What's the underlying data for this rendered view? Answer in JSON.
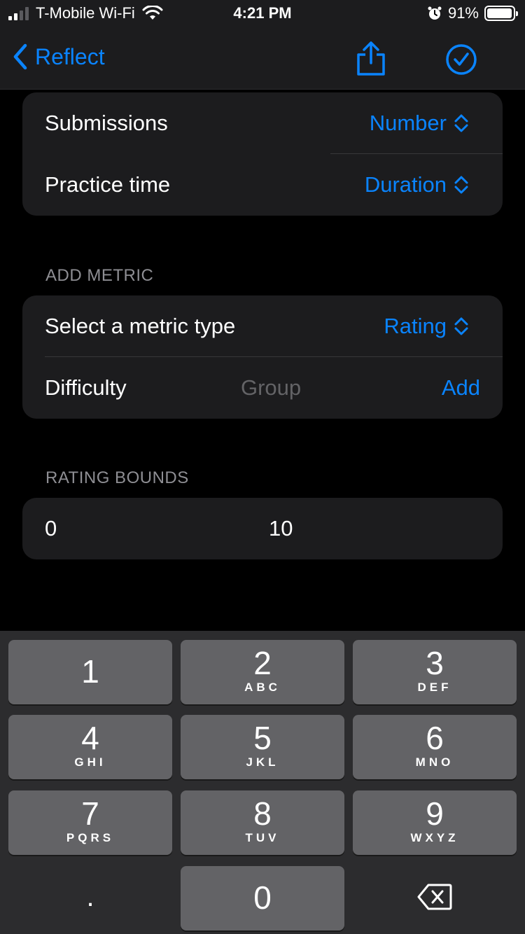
{
  "status": {
    "carrier": "T-Mobile Wi-Fi",
    "time": "4:21 PM",
    "battery": "91%"
  },
  "nav": {
    "back_label": "Reflect"
  },
  "metrics": [
    {
      "label": "Submissions",
      "value": "Number"
    },
    {
      "label": "Practice time",
      "value": "Duration"
    }
  ],
  "add_metric": {
    "header": "ADD METRIC",
    "type_label": "Select a metric type",
    "type_value": "Rating",
    "name_value": "Difficulty",
    "group_placeholder": "Group",
    "add_label": "Add"
  },
  "rating_bounds": {
    "header": "RATING BOUNDS",
    "min": "0",
    "max": "10"
  },
  "keypad": {
    "keys": [
      {
        "digit": "1",
        "letters": ""
      },
      {
        "digit": "2",
        "letters": "ABC"
      },
      {
        "digit": "3",
        "letters": "DEF"
      },
      {
        "digit": "4",
        "letters": "GHI"
      },
      {
        "digit": "5",
        "letters": "JKL"
      },
      {
        "digit": "6",
        "letters": "MNO"
      },
      {
        "digit": "7",
        "letters": "PQRS"
      },
      {
        "digit": "8",
        "letters": "TUV"
      },
      {
        "digit": "9",
        "letters": "WXYZ"
      },
      {
        "digit": "0",
        "letters": ""
      }
    ],
    "decimal": "."
  },
  "colors": {
    "accent": "#0a84ff",
    "background": "#000000",
    "card": "#1c1c1e",
    "key": "#636366",
    "keyboard": "#2c2c2e"
  }
}
